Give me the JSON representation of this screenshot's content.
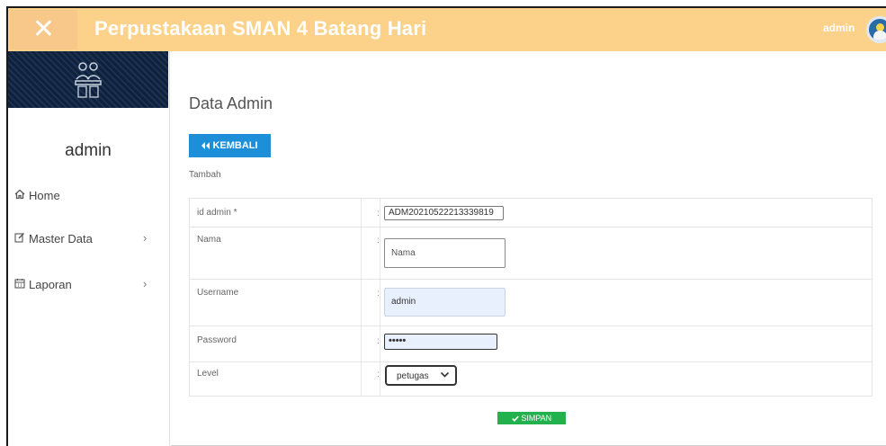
{
  "header": {
    "close_icon": "close-icon",
    "title": "Perpustakaan SMAN 4 Batang Hari",
    "user_label": "admin",
    "avatar_icon": "user-avatar-icon",
    "accent_color": "#fcd28a"
  },
  "sidebar": {
    "banner_icon": "library-illustration-icon",
    "user_name": "admin",
    "items": [
      {
        "label": "Home",
        "icon": "home-icon",
        "has_submenu": false
      },
      {
        "label": "Master Data",
        "icon": "edit-icon",
        "has_submenu": true,
        "chevron": "›"
      },
      {
        "label": "Laporan",
        "icon": "calendar-icon",
        "has_submenu": true,
        "chevron": "›"
      }
    ]
  },
  "main": {
    "page_title": "Data Admin",
    "back_button": {
      "icon": "double-chevron-left-icon",
      "label": "KEMBALI"
    },
    "section_label": "Tambah",
    "form": {
      "separator": ":",
      "rows": [
        {
          "label": "id admin *",
          "type": "text",
          "value": "ADM20210522213339819"
        },
        {
          "label": "Nama",
          "type": "text",
          "value": "",
          "placeholder": "Nama"
        },
        {
          "label": "Username",
          "type": "text",
          "value": "admin"
        },
        {
          "label": "Password",
          "type": "password",
          "value": "•••••"
        },
        {
          "label": "Level",
          "type": "select",
          "value": "petugas",
          "chevron": "∨"
        }
      ]
    },
    "save_button": {
      "icon": "check-icon",
      "label": "SIMPAN"
    },
    "colors": {
      "primary": "#1d8fd8",
      "success": "#22b14c"
    }
  }
}
